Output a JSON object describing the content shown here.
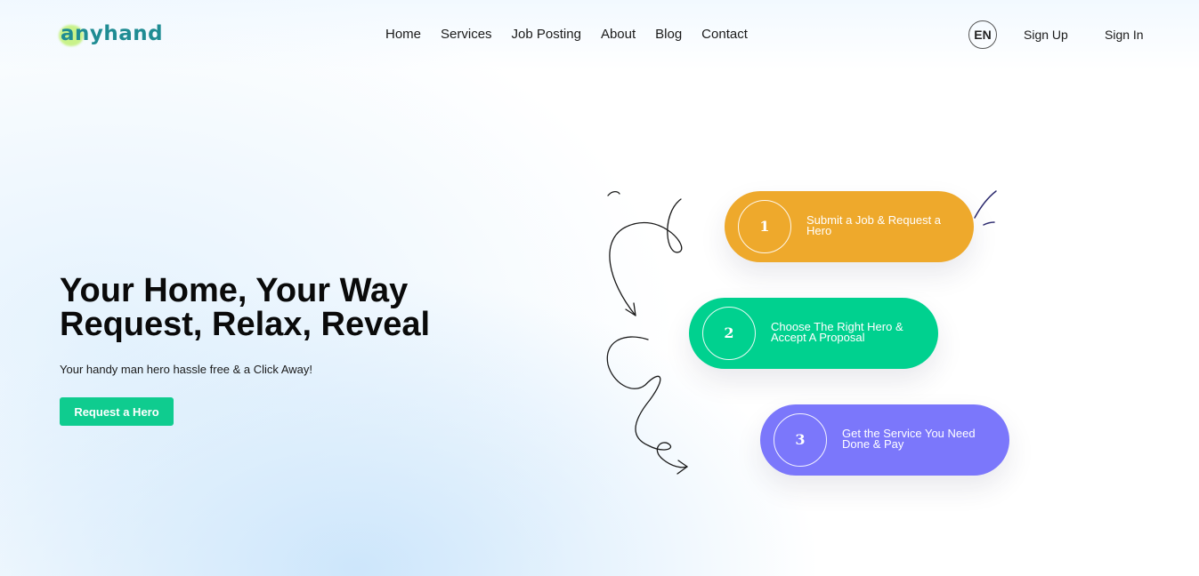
{
  "header": {
    "logo": "anyhand",
    "nav": [
      "Home",
      "Services",
      "Job Posting",
      "About",
      "Blog",
      "Contact"
    ],
    "language": "EN",
    "sign_up": "Sign Up",
    "sign_in": "Sign In"
  },
  "hero": {
    "title_line1": "Your Home, Your Way",
    "title_line2": "Request, Relax, Reveal",
    "subtitle": "Your handy man hero hassle free & a Click Away!",
    "cta": "Request a Hero"
  },
  "steps": [
    {
      "number": "1",
      "text": "Submit a Job & Request a Hero",
      "color": "#eea92c"
    },
    {
      "number": "2",
      "text": "Choose The Right Hero & Accept A Proposal",
      "color": "#00d18f"
    },
    {
      "number": "3",
      "text": "Get the Service You Need Done & Pay",
      "color": "#7b77fb"
    }
  ],
  "colors": {
    "brand": "#1f8c93",
    "accent": "#0fcc8f"
  }
}
